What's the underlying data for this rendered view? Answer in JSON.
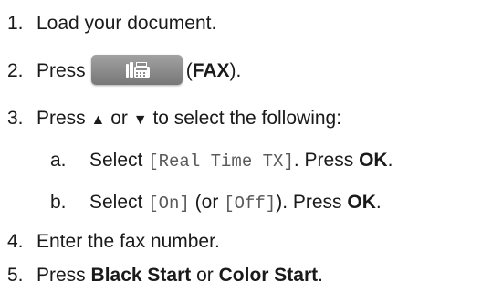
{
  "steps": [
    {
      "number": "1.",
      "text": "Load your document."
    },
    {
      "number": "2.",
      "before": "Press",
      "paren_open": "(",
      "bold": "FAX",
      "paren_close": ").",
      "button_icon": "fax-icon"
    },
    {
      "number": "3.",
      "before": "Press",
      "up_arrow": "▲",
      "middle": "or",
      "down_arrow": "▼",
      "after": "to select the following:"
    },
    {
      "number": "4.",
      "text": "Enter the fax number."
    },
    {
      "number": "5.",
      "before": "Press",
      "bold1": "Black Start",
      "middle": "or",
      "bold2": "Color Start",
      "after": "."
    }
  ],
  "substeps": [
    {
      "letter": "a.",
      "select": "Select",
      "code": "[Real Time TX]",
      "after": ". Press",
      "bold": "OK",
      "end": "."
    },
    {
      "letter": "b.",
      "select": "Select",
      "code1": "[On]",
      "paren_open": "(or",
      "code2": "[Off]",
      "paren_close": "). Press",
      "bold": "OK",
      "end": "."
    }
  ],
  "colors": {
    "button_top": "#a2a2a2",
    "button_bottom": "#777777",
    "icon": "#ffffff",
    "code_text": "#5a5a5a"
  }
}
